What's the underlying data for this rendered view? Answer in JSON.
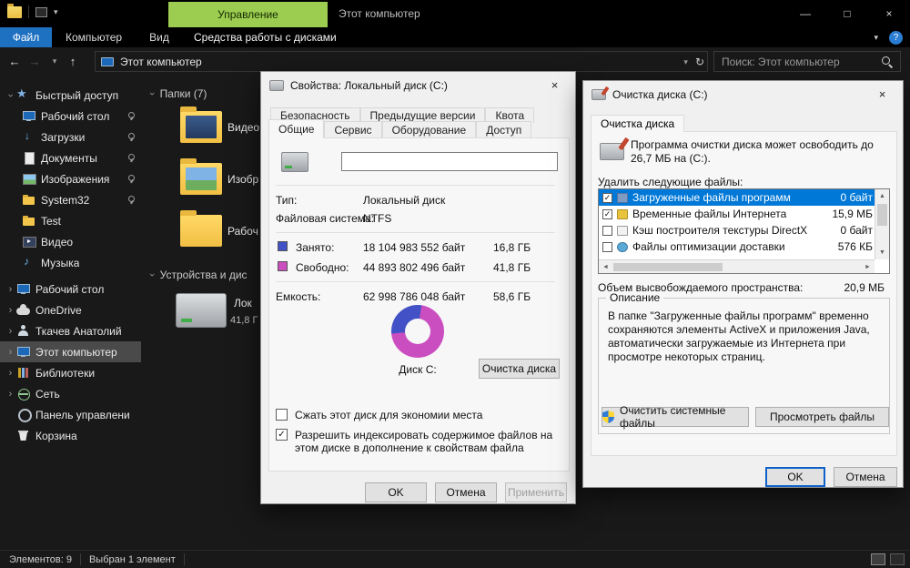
{
  "icons": {
    "back": "←",
    "forward": "→",
    "up": "↑",
    "dropdown": "▾",
    "refresh": "↻",
    "minimize": "—",
    "maximize": "□",
    "close": "×",
    "help": "?",
    "chevron_right": "›",
    "check": "✓",
    "scroll_up": "▲",
    "scroll_down": "▼",
    "scroll_left": "◄",
    "scroll_right": "►"
  },
  "titlebar": {
    "manage_label": "Управление",
    "window_title": "Этот компьютер"
  },
  "ribbon": {
    "file_tab": "Файл",
    "computer_tab": "Компьютер",
    "view_tab": "Вид",
    "disk_tools_tab": "Средства работы с дисками"
  },
  "addressbar": {
    "breadcrumb": "Этот компьютер",
    "search_placeholder": "Поиск: Этот компьютер"
  },
  "sidebar": {
    "items": [
      {
        "label": "Быстрый доступ",
        "pinned": false
      },
      {
        "label": "Рабочий стол",
        "pinned": true
      },
      {
        "label": "Загрузки",
        "pinned": true
      },
      {
        "label": "Документы",
        "pinned": true
      },
      {
        "label": "Изображения",
        "pinned": true
      },
      {
        "label": "System32",
        "pinned": true
      },
      {
        "label": "Test",
        "pinned": false
      },
      {
        "label": "Видео",
        "pinned": false
      },
      {
        "label": "Музыка",
        "pinned": false
      },
      {
        "label": "Рабочий стол",
        "pinned": false
      },
      {
        "label": "OneDrive",
        "pinned": false
      },
      {
        "label": "Ткачев Анатолий",
        "pinned": false
      },
      {
        "label": "Этот компьютер",
        "pinned": false,
        "selected": true
      },
      {
        "label": "Библиотеки",
        "pinned": false
      },
      {
        "label": "Сеть",
        "pinned": false
      },
      {
        "label": "Панель управлени",
        "pinned": false
      },
      {
        "label": "Корзина",
        "pinned": false
      }
    ]
  },
  "content": {
    "folders_header": "Папки (7)",
    "folder_tiles": [
      {
        "label": "Видео"
      },
      {
        "label": "Изобр"
      },
      {
        "label": "Рабоч"
      }
    ],
    "devices_header": "Устройства и дис",
    "drive_tile": {
      "line1": "Лок",
      "line2": "41,8 Г"
    }
  },
  "properties_dialog": {
    "title": "Свойства: Локальный диск (C:)",
    "tabs_back": [
      "Безопасность",
      "Предыдущие версии",
      "Квота"
    ],
    "tabs_front": [
      "Общие",
      "Сервис",
      "Оборудование",
      "Доступ"
    ],
    "volume_label_value": "",
    "rows": {
      "type_label": "Тип:",
      "type_value": "Локальный диск",
      "fs_label": "Файловая система:",
      "fs_value": "NTFS",
      "used_label": "Занято:",
      "used_bytes": "18 104 983 552 байт",
      "used_size": "16,8 ГБ",
      "free_label": "Свободно:",
      "free_bytes": "44 893 802 496 байт",
      "free_size": "41,8 ГБ",
      "capacity_label": "Емкость:",
      "capacity_bytes": "62 998 786 048 байт",
      "capacity_size": "58,6 ГБ"
    },
    "donut": {
      "used_percent": 28.7,
      "used_color": "#4251c5",
      "free_color": "#cb4ec1",
      "label": "Диск C:"
    },
    "cleanup_button": "Очистка диска",
    "compress_checkbox": "Сжать этот диск для экономии места",
    "index_checkbox": "Разрешить индексировать содержимое файлов на этом диске в дополнение к свойствам файла",
    "ok": "OK",
    "cancel": "Отмена",
    "apply": "Применить"
  },
  "cleanup_dialog": {
    "title": "Очистка диска  (C:)",
    "tab": "Очистка диска",
    "intro": "Программа очистки диска может освободить до 26,7 МБ на (C:).",
    "delete_label": "Удалить следующие файлы:",
    "files": [
      {
        "name": "Загруженные файлы программ",
        "size": "0 байт",
        "checked": true,
        "selected": true
      },
      {
        "name": "Временные файлы Интернета",
        "size": "15,9 МБ",
        "checked": true,
        "selected": false
      },
      {
        "name": "Кэш построителя текстуры DirectX",
        "size": "0 байт",
        "checked": false,
        "selected": false
      },
      {
        "name": "Файлы оптимизации доставки",
        "size": "576 КБ",
        "checked": false,
        "selected": false
      }
    ],
    "space_label": "Объем высвобождаемого пространства:",
    "space_value": "20,9 МБ",
    "description_title": "Описание",
    "description_text": "В папке \"Загруженные файлы программ\" временно сохраняются элементы ActiveX и приложения Java, автоматически загружаемые из Интернета при просмотре некоторых страниц.",
    "system_files_button": "Очистить системные файлы",
    "view_files_button": "Просмотреть файлы",
    "ok": "OK",
    "cancel": "Отмена"
  },
  "statusbar": {
    "items_count": "Элементов: 9",
    "selection": "Выбран 1 элемент"
  }
}
